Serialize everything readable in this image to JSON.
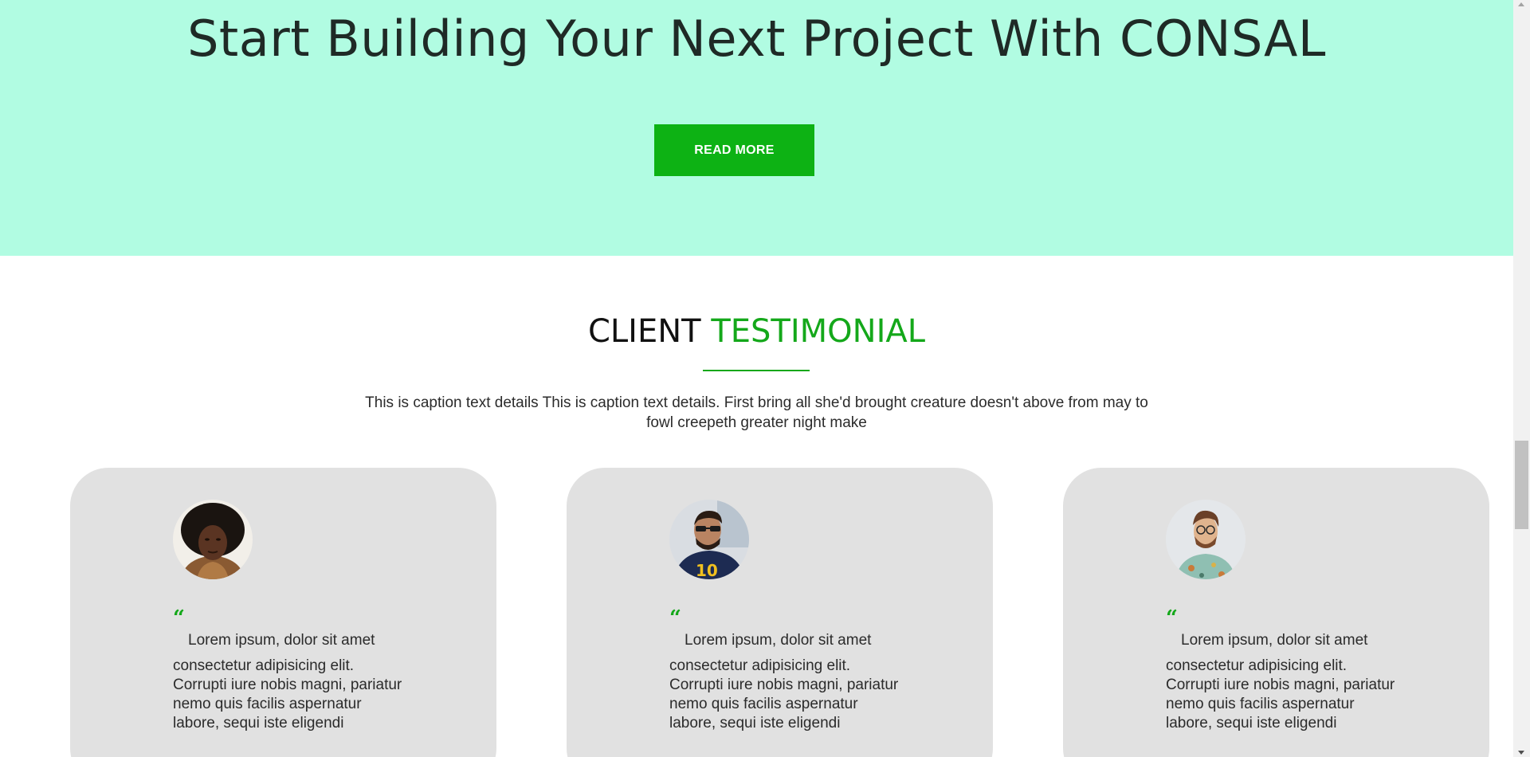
{
  "hero": {
    "title": "Start Building Your Next Project With CONSAL",
    "button_label": "READ MORE"
  },
  "testimonials": {
    "title_main": "CLIENT",
    "title_accent": "TESTIMONIAL",
    "caption": "This is caption text details This is caption text details. First bring all she'd brought creature doesn't above from may to fowl creepeth greater night make",
    "cards": [
      {
        "quote_mark": "“",
        "quote_first": "Lorem ipsum, dolor sit amet",
        "quote_rest": "consectetur adipisicing elit. Corrupti iure nobis magni, pariatur nemo quis facilis aspernatur labore, sequi iste eligendi"
      },
      {
        "quote_mark": "“",
        "quote_first": "Lorem ipsum, dolor sit amet",
        "quote_rest": "consectetur adipisicing elit. Corrupti iure nobis magni, pariatur nemo quis facilis aspernatur labore, sequi iste eligendi"
      },
      {
        "quote_mark": "“",
        "quote_first": "Lorem ipsum, dolor sit amet",
        "quote_rest": "consectetur adipisicing elit. Corrupti iure nobis magni, pariatur nemo quis facilis aspernatur labore, sequi iste eligendi"
      }
    ]
  },
  "colors": {
    "hero_background": "#b1fce2",
    "accent_green": "#14a81a",
    "button_green": "#0db214",
    "card_background": "#e1e1e1"
  }
}
